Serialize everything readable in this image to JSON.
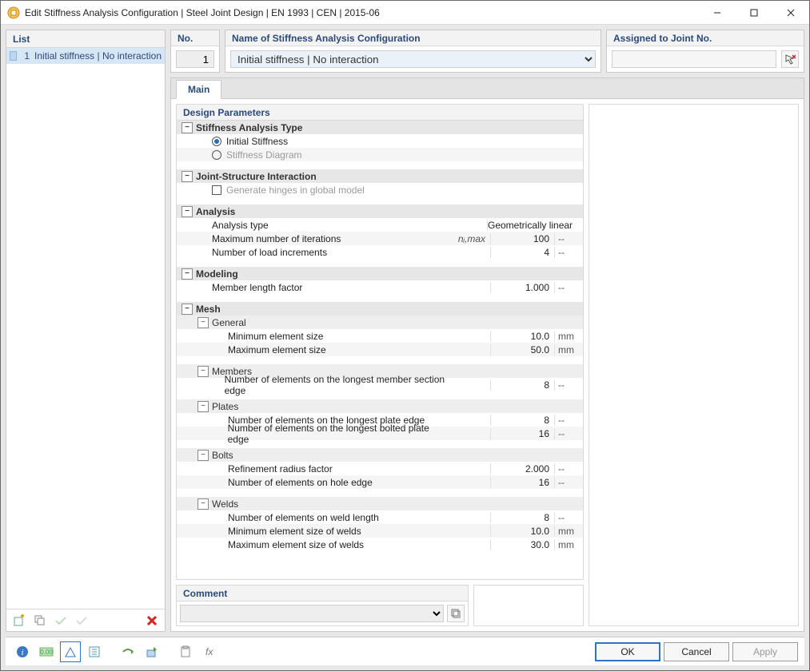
{
  "window": {
    "title": "Edit Stiffness Analysis Configuration | Steel Joint Design | EN 1993 | CEN | 2015-06"
  },
  "left": {
    "header": "List",
    "items": [
      {
        "no": "1",
        "label": "Initial stiffness | No interaction"
      }
    ]
  },
  "top": {
    "no_label": "No.",
    "no_value": "1",
    "name_label": "Name of Stiffness Analysis Configuration",
    "name_value": "Initial stiffness | No interaction",
    "assign_label": "Assigned to Joint No.",
    "assign_value": ""
  },
  "tabs": {
    "main": "Main"
  },
  "params": {
    "header": "Design Parameters",
    "stiffness_type": {
      "group": "Stiffness Analysis Type",
      "initial": "Initial Stiffness",
      "diagram": "Stiffness Diagram"
    },
    "jsi": {
      "group": "Joint-Structure Interaction",
      "generate": "Generate hinges in global model"
    },
    "analysis": {
      "group": "Analysis",
      "type_label": "Analysis type",
      "type_value": "Geometrically linear",
      "maxiter_label": "Maximum number of iterations",
      "maxiter_sym": "nᵢ,max",
      "maxiter_value": "100",
      "maxiter_unit": "--",
      "incr_label": "Number of load increments",
      "incr_value": "4",
      "incr_unit": "--"
    },
    "modeling": {
      "group": "Modeling",
      "mlf_label": "Member length factor",
      "mlf_value": "1.000",
      "mlf_unit": "--"
    },
    "mesh": {
      "group": "Mesh",
      "general": {
        "group": "General",
        "min_label": "Minimum element size",
        "min_value": "10.0",
        "min_unit": "mm",
        "max_label": "Maximum element size",
        "max_value": "50.0",
        "max_unit": "mm"
      },
      "members": {
        "group": "Members",
        "edge_label": "Number of elements on the longest member section edge",
        "edge_value": "8",
        "edge_unit": "--"
      },
      "plates": {
        "group": "Plates",
        "p1_label": "Number of elements on the longest plate edge",
        "p1_value": "8",
        "p1_unit": "--",
        "p2_label": "Number of elements on the longest bolted plate edge",
        "p2_value": "16",
        "p2_unit": "--"
      },
      "bolts": {
        "group": "Bolts",
        "rrf_label": "Refinement radius factor",
        "rrf_value": "2.000",
        "rrf_unit": "--",
        "hole_label": "Number of elements on hole edge",
        "hole_value": "16",
        "hole_unit": "--"
      },
      "welds": {
        "group": "Welds",
        "len_label": "Number of elements on weld length",
        "len_value": "8",
        "len_unit": "--",
        "min_label": "Minimum element size of welds",
        "min_value": "10.0",
        "min_unit": "mm",
        "max_label": "Maximum element size of welds",
        "max_value": "30.0",
        "max_unit": "mm"
      }
    }
  },
  "comment": {
    "header": "Comment",
    "value": ""
  },
  "footer": {
    "ok": "OK",
    "cancel": "Cancel",
    "apply": "Apply"
  }
}
